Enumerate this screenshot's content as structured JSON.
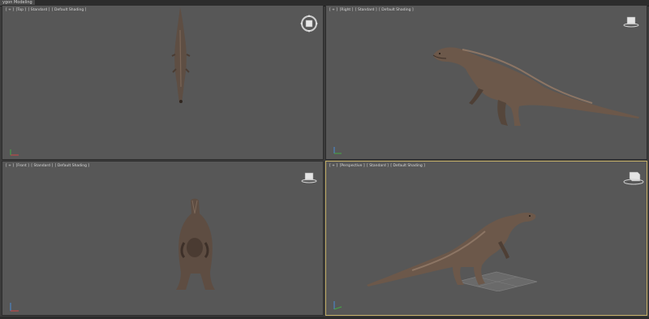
{
  "ribbon": {
    "active_tab": "ygon Modeling"
  },
  "viewports": {
    "top": {
      "bracket": "[ + ]",
      "view": "[Top ]",
      "style": "[ Standard ]",
      "shading": "[ Default Shading ]"
    },
    "right": {
      "bracket": "[ + ]",
      "view": "[Right ]",
      "style": "[ Standard ]",
      "shading": "[ Default Shading ]"
    },
    "front": {
      "bracket": "[ + ]",
      "view": "[Front ]",
      "style": "[ Standard ]",
      "shading": "[ Default Shading ]"
    },
    "perspective": {
      "bracket": "[ + ]",
      "view": "[Perspective ]",
      "style": "[ Standard ]",
      "shading": "[ Default Shading ]"
    }
  },
  "active_viewport": "perspective",
  "colors": {
    "active_border": "#c7b26a",
    "viewport_bg": "#575757",
    "model": "#6e5a4c"
  }
}
